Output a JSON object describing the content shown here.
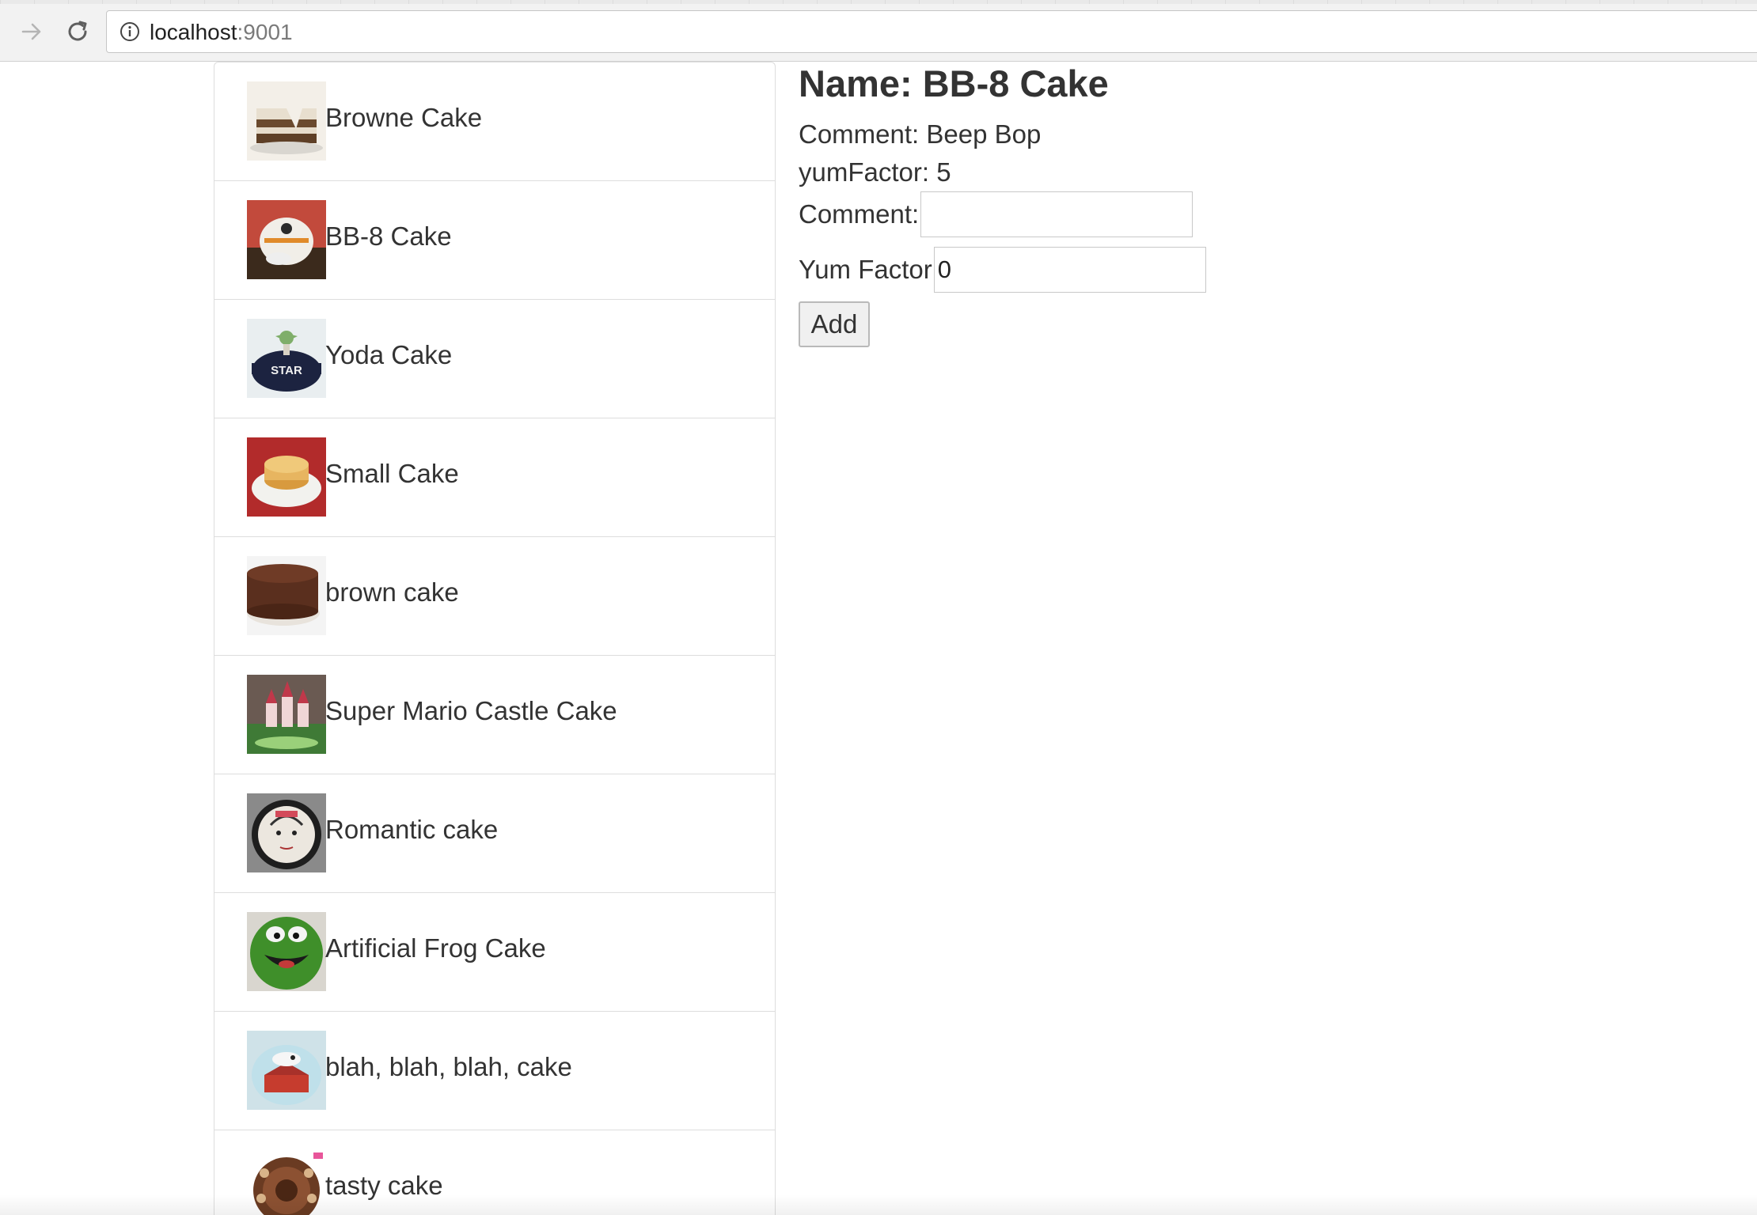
{
  "browser": {
    "url_host": "localhost",
    "url_port": ":9001",
    "back_icon": "arrow-right-icon",
    "reload_icon": "reload-icon",
    "info_icon": "info-icon"
  },
  "cakes": [
    {
      "name": "Browne Cake",
      "thumb_icon": "cake-photo"
    },
    {
      "name": "BB-8 Cake",
      "thumb_icon": "cake-photo"
    },
    {
      "name": "Yoda Cake",
      "thumb_icon": "cake-photo"
    },
    {
      "name": "Small Cake",
      "thumb_icon": "cake-photo"
    },
    {
      "name": "brown cake",
      "thumb_icon": "cake-photo"
    },
    {
      "name": "Super Mario Castle Cake",
      "thumb_icon": "cake-photo"
    },
    {
      "name": "Romantic cake",
      "thumb_icon": "cake-photo"
    },
    {
      "name": "Artificial Frog Cake",
      "thumb_icon": "cake-photo"
    },
    {
      "name": "blah, blah, blah, cake",
      "thumb_icon": "cake-photo"
    },
    {
      "name": "tasty cake",
      "thumb_icon": "cake-photo"
    }
  ],
  "detail": {
    "title": "Name: BB-8 Cake",
    "comment_text": "Comment: Beep Bop",
    "yum_text": "yumFactor: 5",
    "form": {
      "comment_label": "Comment:",
      "comment_value": "",
      "yum_label": "Yum Factor",
      "yum_value": "0",
      "add_label": "Add"
    }
  },
  "colors": {
    "text": "#333333",
    "border": "#dddddd",
    "chrome_bg": "#f2f2f2"
  }
}
